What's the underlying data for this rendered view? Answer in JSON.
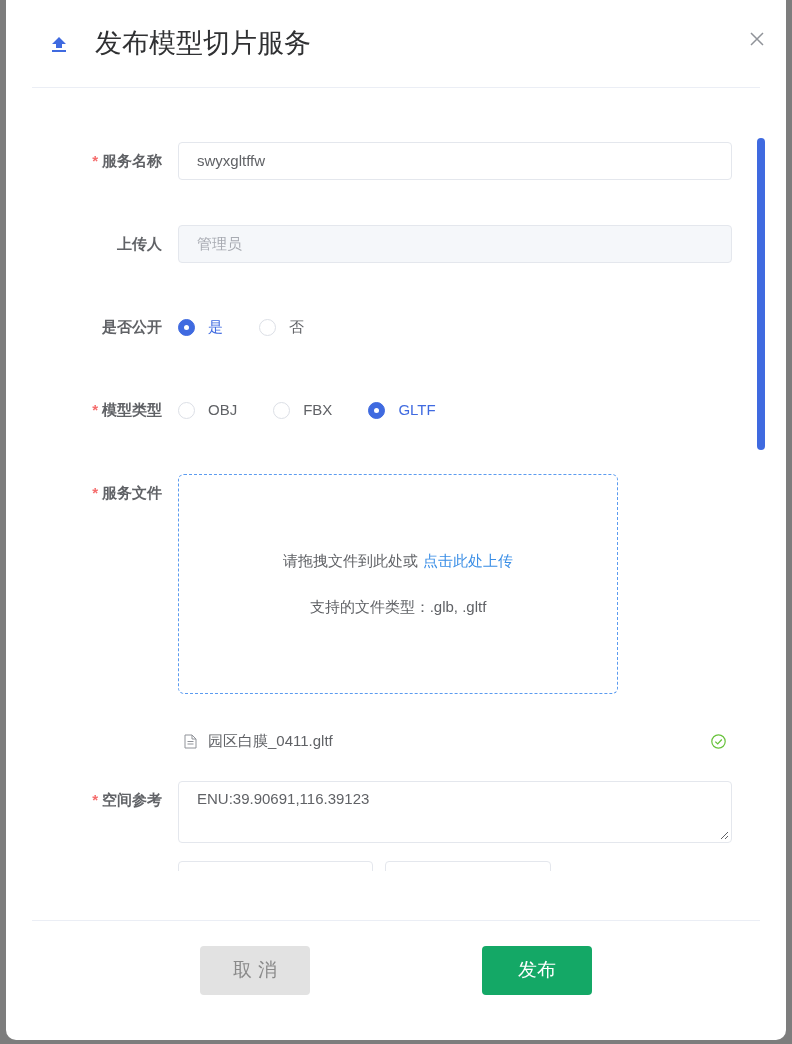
{
  "dialog": {
    "title": "发布模型切片服务"
  },
  "fields": [
    {
      "kind": "text",
      "label": "服务名称",
      "required_mark": "*",
      "value": "swyxgltffw",
      "disabled": false
    },
    {
      "kind": "text",
      "label": "上传人",
      "placeholder": "管理员",
      "disabled": true
    },
    {
      "kind": "radio",
      "label": "是否公开",
      "options": [
        {
          "label": "是",
          "selected": true
        },
        {
          "label": "否",
          "selected": false
        }
      ]
    },
    {
      "kind": "radio",
      "label": "模型类型",
      "required_mark": "*",
      "options": [
        {
          "label": "OBJ",
          "selected": false
        },
        {
          "label": "FBX",
          "selected": false
        },
        {
          "label": "GLTF",
          "selected": true
        }
      ]
    },
    {
      "kind": "upload",
      "label": "服务文件",
      "required_mark": "*",
      "prompt": "请拖拽文件到此处或",
      "link": "点击此处上传",
      "hint": "支持的文件类型：.glb, .gltf",
      "files": [
        {
          "name": "园区白膜_0411.gltf",
          "done": true
        }
      ]
    },
    {
      "kind": "textarea",
      "label": "空间参考",
      "required_mark": "*",
      "value": "ENU:39.90691,116.39123"
    }
  ],
  "buttons": [
    {
      "label": "取 消",
      "kind": "secondary"
    },
    {
      "label": "发布",
      "kind": "primary"
    }
  ]
}
